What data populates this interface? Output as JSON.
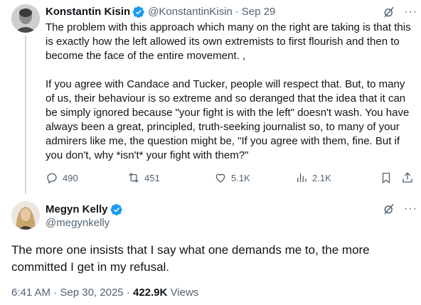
{
  "tweet1": {
    "author_name": "Konstantin Kisin",
    "handle": "@KonstantinKisin",
    "separator": "·",
    "date": "Sep 29",
    "paragraph1": "The problem with this approach which many on the right are taking is that this is exactly how the left allowed its own extremists to first flourish and then to become the face of the entire movement. ,",
    "paragraph2": "If you agree with Candace and Tucker, people will respect that. But, to many of us, their behaviour is so extreme and so deranged that the idea that it can be simply ignored because \"your fight is with the left\" doesn't wash. You have always been a great, principled, truth-seeking journalist so, to many of your admirers like me, the question might be, \"If you agree with them, fine. But if you don't, why *isn't* your fight with them?\"",
    "more_label": "···",
    "stats": {
      "replies": "490",
      "reposts": "451",
      "likes": "5.1K",
      "views": "2.1K"
    }
  },
  "tweet2": {
    "author_name": "Megyn Kelly",
    "handle": "@megynkelly",
    "more_label": "···",
    "text": "The more one insists that I say what one demands me to, the more committed I get in my refusal.",
    "time": "6:41 AM",
    "separator": "·",
    "date": "Sep 30, 2025",
    "separator2": "·",
    "views_count": "422.9K",
    "views_label": "Views"
  },
  "colors": {
    "text": "#0f1419",
    "muted": "#536471",
    "verified": "#1d9bf0",
    "thread_line": "#cfd9de"
  },
  "icons": [
    "verified-badge-icon",
    "grok-icon",
    "more-icon",
    "reply-icon",
    "repost-icon",
    "like-icon",
    "views-icon",
    "bookmark-icon",
    "share-icon"
  ]
}
